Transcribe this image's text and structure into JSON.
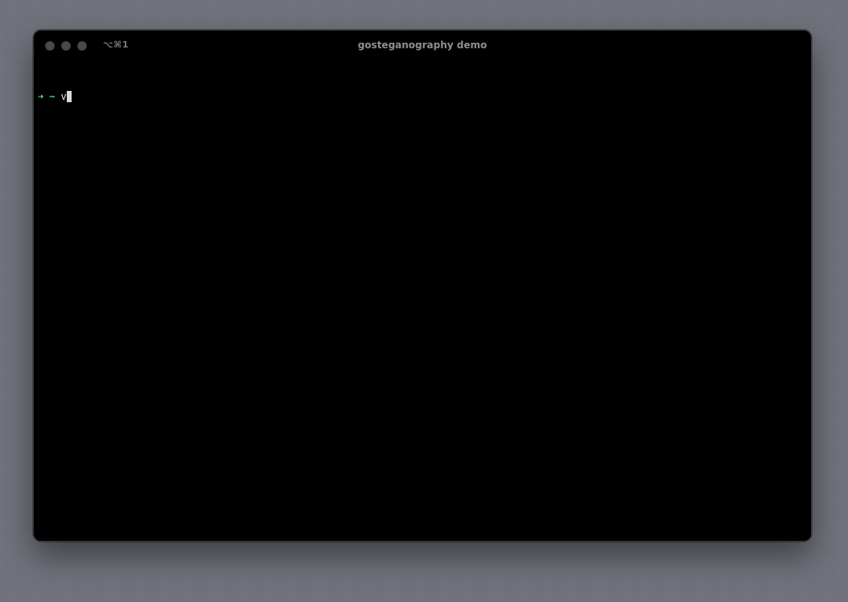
{
  "window": {
    "title": "gosteganography demo",
    "shortcut": "⌥⌘1"
  },
  "terminal": {
    "prompt_arrow": "➜",
    "prompt_dir": "~",
    "input": "v"
  },
  "colors": {
    "prompt_arrow": "#5fd75f",
    "prompt_dir": "#56c8d8",
    "background": "#000000"
  },
  "icons": {
    "close": "close-button-dot",
    "minimize": "minimize-button-dot",
    "zoom": "zoom-button-dot"
  }
}
